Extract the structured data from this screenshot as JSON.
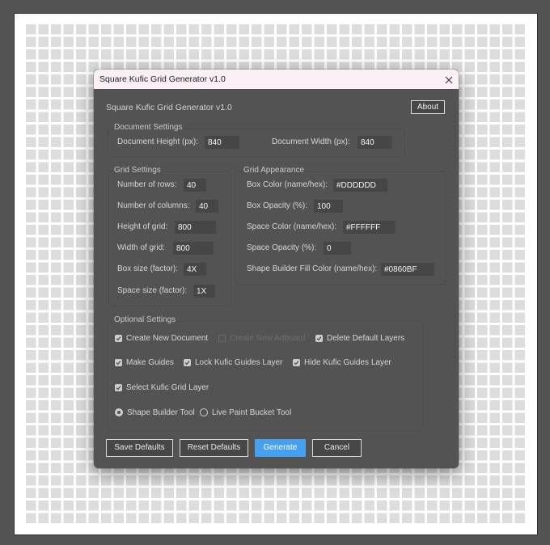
{
  "canvas": {
    "rows": 40,
    "columns": 40,
    "box_color": "#DDDDDD",
    "space_color": "#FFFFFF"
  },
  "window": {
    "title": "Square Kufic Grid Generator v1.0"
  },
  "header": {
    "title": "Square Kufic Grid Generator v1.0",
    "about_label": "About"
  },
  "document_settings": {
    "legend": "Document Settings",
    "height_label": "Document Height (px):",
    "height_value": "840",
    "width_label": "Document Width (px):",
    "width_value": "840"
  },
  "grid_settings": {
    "legend": "Grid Settings",
    "fields": [
      {
        "label": "Number of rows:",
        "value": "40"
      },
      {
        "label": "Number of columns:",
        "value": "40"
      },
      {
        "label": "Height of grid:",
        "value": "800"
      },
      {
        "label": "Width of grid:",
        "value": "800"
      },
      {
        "label": "Box size (factor):",
        "value": "4X"
      },
      {
        "label": "Space size (factor):",
        "value": "1X"
      }
    ]
  },
  "grid_appearance": {
    "legend": "Grid Appearance",
    "fields": [
      {
        "label": "Box Color (name/hex):",
        "value": "#DDDDDD"
      },
      {
        "label": "Box Opacity (%):",
        "value": "100"
      },
      {
        "label": "Space Color (name/hex):",
        "value": "#FFFFFF"
      },
      {
        "label": "Space Opacity (%):",
        "value": "0"
      },
      {
        "label": "Shape Builder Fill Color (name/hex):",
        "value": "#0860BF"
      }
    ]
  },
  "optional_settings": {
    "legend": "Optional Settings",
    "checkboxes": [
      {
        "label": "Create New Document",
        "checked": true,
        "enabled": true
      },
      {
        "label": "Create New Artboard",
        "checked": false,
        "enabled": false
      },
      {
        "label": "Delete Default Layers",
        "checked": true,
        "enabled": true
      },
      {
        "label": "Make Guides",
        "checked": true,
        "enabled": true
      },
      {
        "label": "Lock Kufic Guides Layer",
        "checked": true,
        "enabled": true
      },
      {
        "label": "Hide Kufic Guides Layer",
        "checked": true,
        "enabled": true
      },
      {
        "label": "Select Kufic Grid Layer",
        "checked": true,
        "enabled": true
      }
    ],
    "radios": [
      {
        "label": "Shape Builder Tool",
        "checked": true
      },
      {
        "label": "Live Paint Bucket Tool",
        "checked": false
      }
    ]
  },
  "buttons": {
    "save_defaults": "Save Defaults",
    "reset_defaults": "Reset Defaults",
    "generate": "Generate",
    "cancel": "Cancel"
  },
  "colors": {
    "accent": "#46A0F0",
    "dialog_background": "#535353",
    "titlebar_background": "#F9EFF4"
  }
}
